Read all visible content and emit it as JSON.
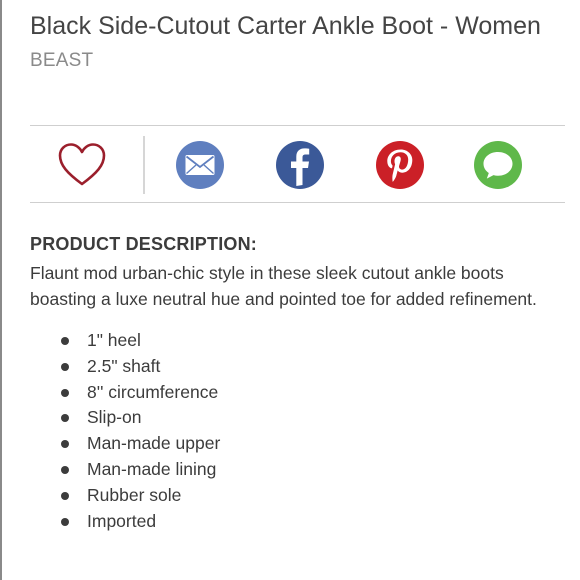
{
  "product": {
    "title": "Black Side-Cutout Carter Ankle Boot - Women",
    "brand": "BEAST"
  },
  "share": {
    "items": [
      {
        "name": "favorite",
        "icon": "heart-icon",
        "color": "#9b1f2c"
      },
      {
        "name": "email",
        "icon": "envelope-icon",
        "color": "#5f7fbf"
      },
      {
        "name": "facebook",
        "icon": "facebook-icon",
        "color": "#3b5998"
      },
      {
        "name": "pinterest",
        "icon": "pinterest-icon",
        "color": "#cb2027"
      },
      {
        "name": "message",
        "icon": "chat-bubble-icon",
        "color": "#5fb84a"
      }
    ]
  },
  "description": {
    "heading": "PRODUCT DESCRIPTION:",
    "body": "Flaunt mod urban-chic style in these sleek cutout ankle boots boasting a luxe neutral hue and pointed toe for added refinement.",
    "features": [
      "1\" heel",
      "2.5\" shaft",
      "8'' circumference",
      "Slip-on",
      "Man-made upper",
      "Man-made lining",
      "Rubber sole",
      "Imported"
    ]
  }
}
